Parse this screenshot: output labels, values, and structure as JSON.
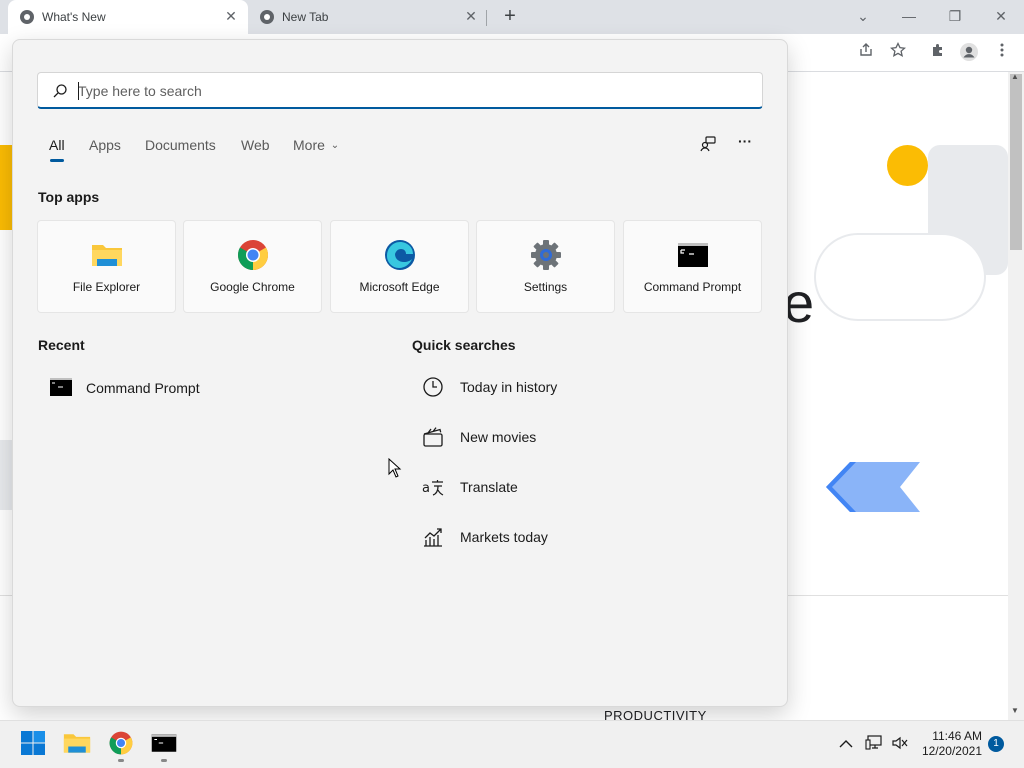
{
  "browser": {
    "tabs": [
      {
        "title": "What's New",
        "active": true
      },
      {
        "title": "New Tab",
        "active": false
      }
    ],
    "close_glyph": "✕",
    "new_tab_glyph": "+",
    "window_controls": {
      "tab_search": "⌄",
      "minimize": "—",
      "restore": "❐",
      "close": "✕"
    },
    "toolbar_icons": [
      "share-icon",
      "star-icon",
      "extensions-icon",
      "profile-icon",
      "menu-icon"
    ],
    "page_text": {
      "productivity": "PRODUCTIVITY",
      "partial_letter": "e"
    }
  },
  "search": {
    "placeholder": "Type here to search",
    "filters": [
      "All",
      "Apps",
      "Documents",
      "Web",
      "More"
    ],
    "active_filter": "All",
    "more_chevron": "⌄",
    "overflow_glyph": "···",
    "top_apps_title": "Top apps",
    "top_apps": [
      {
        "name": "File Explorer",
        "icon": "folder-icon"
      },
      {
        "name": "Google Chrome",
        "icon": "chrome-icon"
      },
      {
        "name": "Microsoft Edge",
        "icon": "edge-icon"
      },
      {
        "name": "Settings",
        "icon": "gear-icon"
      },
      {
        "name": "Command Prompt",
        "icon": "cmd-icon"
      }
    ],
    "recent_title": "Recent",
    "recent": [
      {
        "name": "Command Prompt",
        "icon": "cmd-icon"
      }
    ],
    "quick_title": "Quick searches",
    "quick": [
      {
        "label": "Today in history",
        "icon": "clock-icon"
      },
      {
        "label": "New movies",
        "icon": "clapperboard-icon"
      },
      {
        "label": "Translate",
        "icon": "translate-icon"
      },
      {
        "label": "Markets today",
        "icon": "chart-icon"
      }
    ]
  },
  "taskbar": {
    "apps": [
      "start-icon",
      "file-explorer-icon",
      "chrome-icon",
      "cmd-icon"
    ],
    "time": "11:46 AM",
    "date": "12/20/2021",
    "notifications": "1",
    "tray_chevron": "^"
  },
  "colors": {
    "accent": "#005a9e",
    "chrome_yellow": "#fbbc04",
    "chrome_blue": "#4285f4"
  }
}
